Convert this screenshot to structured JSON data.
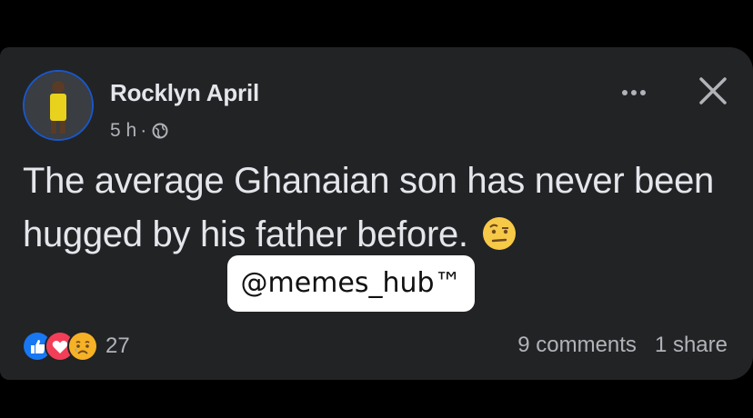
{
  "post": {
    "author": "Rocklyn April",
    "time": "5 h",
    "separator": "·",
    "privacy_icon": "globe-icon",
    "text": "The average Ghanaian son has never been hugged by his father before.",
    "inline_emoji": "raised-eyebrow-emoji",
    "watermark": "@memes_hub™"
  },
  "reactions": {
    "icons": [
      "like-icon",
      "love-icon",
      "sad-icon"
    ],
    "count": "27",
    "comments": "9 comments",
    "shares": "1 share"
  },
  "colors": {
    "background": "#000000",
    "card": "#222325",
    "text_primary": "#e4e6eb",
    "text_secondary": "#b0b3b8",
    "like_blue": "#1877f2",
    "love_red": "#f33e58",
    "emoji_yellow": "#f7b125"
  }
}
